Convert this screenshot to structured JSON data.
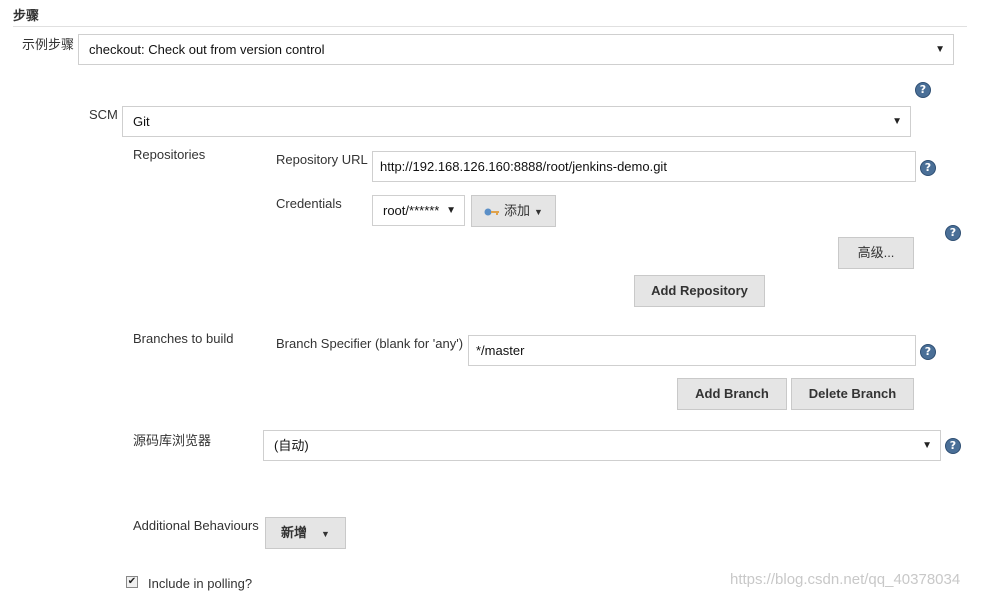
{
  "section": {
    "title": "步骤"
  },
  "sample_step": {
    "label": "示例步骤",
    "value": "checkout: Check out from version control"
  },
  "scm": {
    "label": "SCM",
    "value": "Git"
  },
  "repositories": {
    "label": "Repositories",
    "url_label": "Repository URL",
    "url_value": "http://192.168.126.160:8888/root/jenkins-demo.git",
    "credentials_label": "Credentials",
    "credentials_value": "root/******",
    "add_label": "添加",
    "advanced_label": "高级...",
    "add_repository_label": "Add Repository"
  },
  "branches": {
    "label": "Branches to build",
    "specifier_label": "Branch Specifier (blank for 'any')",
    "specifier_value": "*/master",
    "add_branch_label": "Add Branch",
    "delete_branch_label": "Delete Branch"
  },
  "repo_browser": {
    "label": "源码库浏览器",
    "value": "(自动)"
  },
  "behaviours": {
    "label": "Additional Behaviours",
    "add_label": "新增"
  },
  "polling": {
    "label": "Include in polling?",
    "checked": true
  },
  "help_glyph": "?",
  "caret_glyph": "▼",
  "check_glyph": "✔",
  "watermark": "https://blog.csdn.net/qq_40378034",
  "colors": {
    "help": "#4a6f97",
    "button_bg": "#e5e5e5",
    "border": "#cfcfcf",
    "key_icon": "#5b8fc7"
  },
  "icons": {
    "help": "help-icon",
    "dropdown": "chevron-down-icon",
    "key": "key-icon",
    "check": "check-icon"
  }
}
